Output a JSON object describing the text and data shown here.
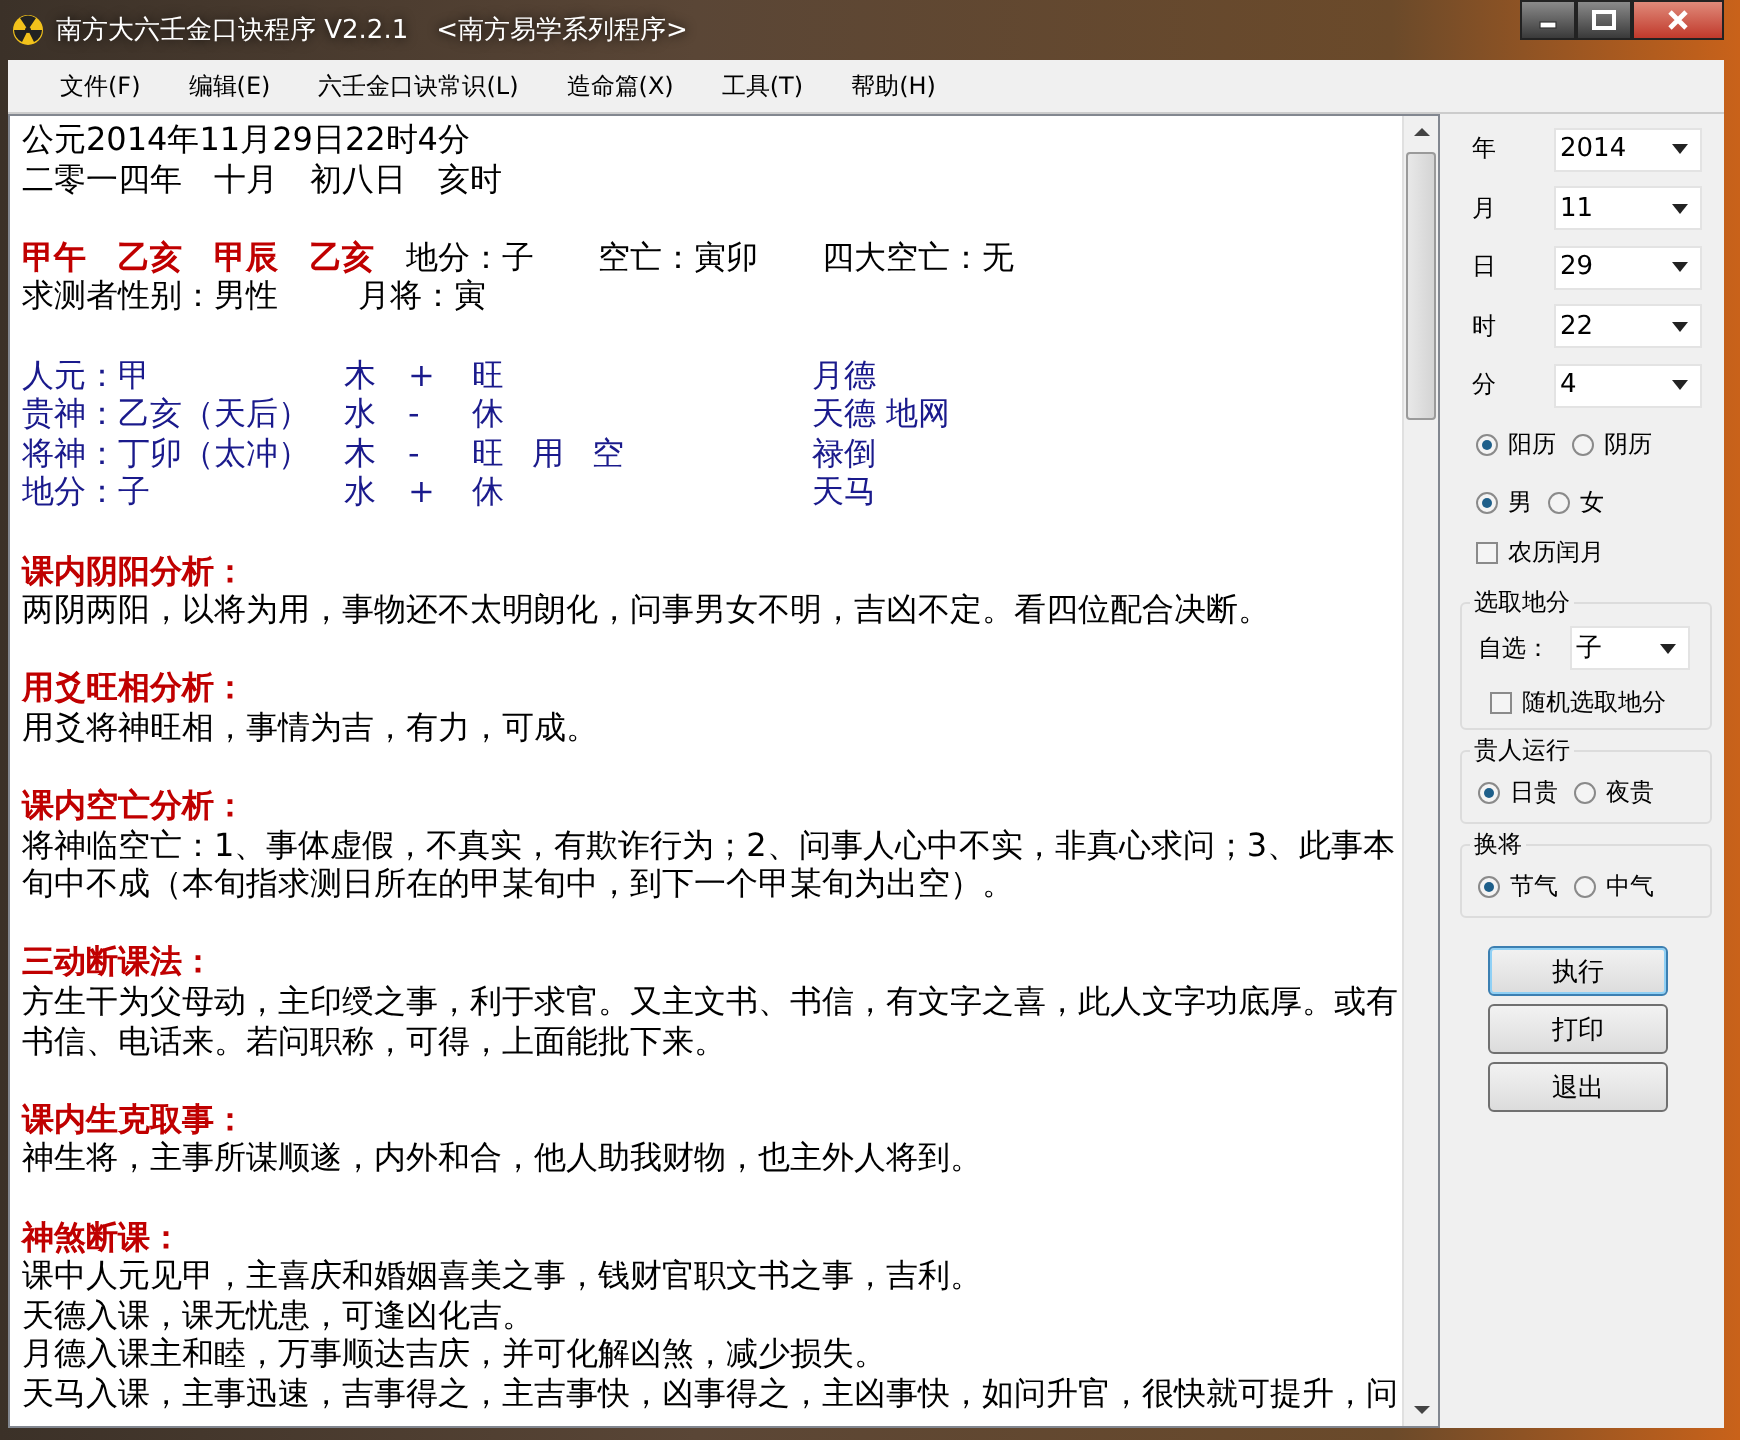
{
  "window": {
    "title": "南方大六壬金口诀程序 V2.2.1",
    "subtitle": "<南方易学系列程序>"
  },
  "menu": [
    "文件(F)",
    "编辑(E)",
    "六壬金口诀常识(L)",
    "造命篇(X)",
    "工具(T)",
    "帮助(H)"
  ],
  "result": {
    "date_lines": [
      "公元2014年11月29日22时4分",
      "二零一四年　十月　初八日　亥时"
    ],
    "pillars": [
      "甲午",
      "乙亥",
      "甲辰",
      "乙亥"
    ],
    "pillar_info": [
      "地分：子",
      "空亡：寅卯",
      "四大空亡：无"
    ],
    "person_info": [
      "求测者性别：男性",
      "月将：寅"
    ],
    "positions": [
      {
        "name": "人元：甲",
        "element": "木",
        "sign": "+",
        "state": "旺",
        "gods": "月德"
      },
      {
        "name": "贵神：乙亥（天后）",
        "element": "水",
        "sign": "-",
        "state": "休",
        "gods": "天德 地网"
      },
      {
        "name": "将神：丁卯（太冲）",
        "element": "木",
        "sign": "-",
        "state": "旺",
        "marks": [
          "用",
          "空"
        ],
        "gods": "禄倒"
      },
      {
        "name": "地分：子",
        "element": "水",
        "sign": "+",
        "state": "休",
        "gods": "天马"
      }
    ],
    "sections": [
      {
        "heading": "课内阴阳分析：",
        "paragraphs": [
          "两阴两阳，以将为用，事物还不太明朗化，问事男女不明，吉凶不定。看四位配合决断。"
        ]
      },
      {
        "heading": "用爻旺相分析：",
        "paragraphs": [
          "用爻将神旺相，事情为吉，有力，可成。"
        ]
      },
      {
        "heading": "课内空亡分析：",
        "paragraphs": [
          "将神临空亡：1、事体虚假，不真实，有欺诈行为；2、问事人心中不实，非真心求问；3、此事本旬中不成（本旬指求测日所在的甲某旬中，到下一个甲某旬为出空）。"
        ]
      },
      {
        "heading": "三动断课法：",
        "paragraphs": [
          "方生干为父母动，主印绶之事，利于求官。又主文书、书信，有文字之喜，此人文字功底厚。或有书信、电话来。若问职称，可得，上面能批下来。"
        ]
      },
      {
        "heading": "课内生克取事：",
        "paragraphs": [
          "神生将，主事所谋顺遂，内外和合，他人助我财物，也主外人将到。"
        ]
      },
      {
        "heading": "神煞断课：",
        "paragraphs": [
          "课中人元见甲，主喜庆和婚姻喜美之事，钱财官职文书之事，吉利。",
          "天德入课，课无忧患，可逢凶化吉。",
          "月德入课主和睦，万事顺达吉庆，并可化解凶煞，减少损失。",
          "天马入课，主事迅速，吉事得之，主吉事快，凶事得之，主凶事快，如问升官，很快就可提升，问"
        ]
      }
    ]
  },
  "side_panel": {
    "fields": [
      {
        "label": "年",
        "value": "2014"
      },
      {
        "label": "月",
        "value": "11"
      },
      {
        "label": "日",
        "value": "29"
      },
      {
        "label": "时",
        "value": "22"
      },
      {
        "label": "分",
        "value": "4"
      }
    ],
    "calendar_options": [
      {
        "label": "阳历",
        "selected": true
      },
      {
        "label": "阴历",
        "selected": false
      }
    ],
    "gender_options": [
      {
        "label": "男",
        "selected": true
      },
      {
        "label": "女",
        "selected": false
      }
    ],
    "leap_month": {
      "label": "农历闰月",
      "checked": false
    },
    "branch_group": {
      "title": "选取地分",
      "self_label": "自选：",
      "value": "子",
      "random": {
        "label": "随机选取地分",
        "checked": false
      }
    },
    "noble_group": {
      "title": "贵人运行",
      "options": [
        {
          "label": "日贵",
          "selected": true
        },
        {
          "label": "夜贵",
          "selected": false
        }
      ]
    },
    "general_group": {
      "title": "换将",
      "options": [
        {
          "label": "节气",
          "selected": true
        },
        {
          "label": "中气",
          "selected": false
        }
      ]
    },
    "buttons": [
      {
        "label": "执行",
        "default": true
      },
      {
        "label": "打印",
        "default": false
      },
      {
        "label": "退出",
        "default": false
      }
    ]
  }
}
